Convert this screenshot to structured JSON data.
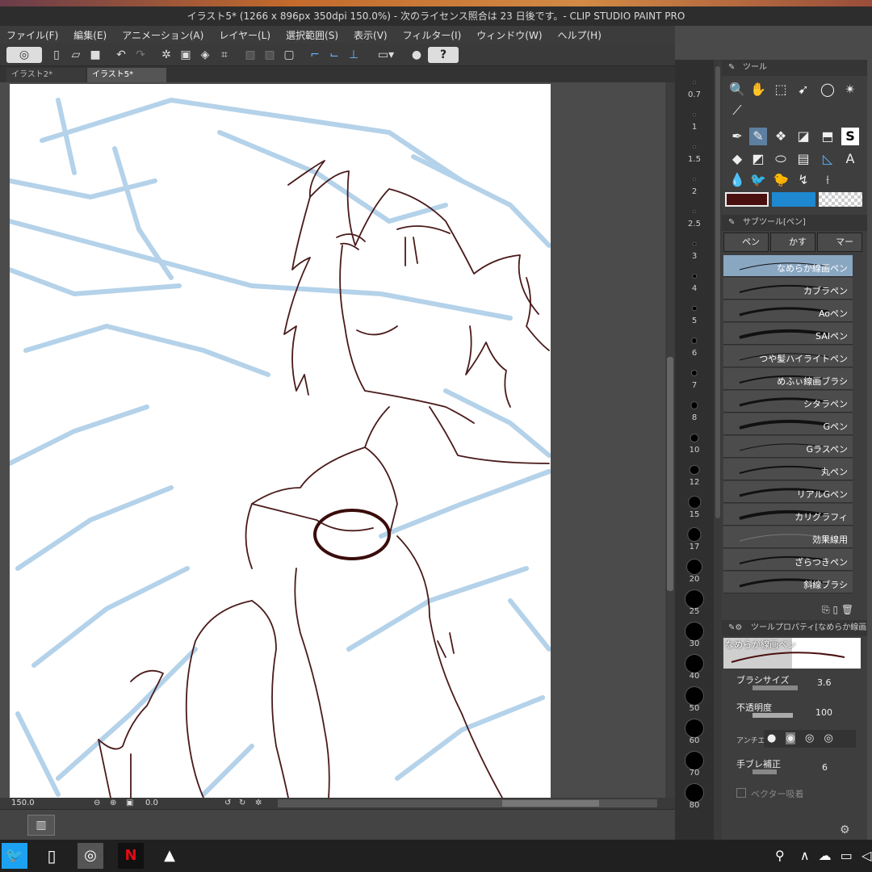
{
  "window": {
    "title": "イラスト5* (1266 x 896px 350dpi 150.0%)  - 次のライセンス照合は 23 日後です。- CLIP STUDIO PAINT PRO"
  },
  "menu": [
    "ファイル(F)",
    "編集(E)",
    "アニメーション(A)",
    "レイヤー(L)",
    "選択範囲(S)",
    "表示(V)",
    "フィルター(I)",
    "ウィンドウ(W)",
    "ヘルプ(H)"
  ],
  "tabs": [
    "イラスト2*",
    "イラスト5*"
  ],
  "status": {
    "zoom": "150.0",
    "angle": "0.0"
  },
  "brush_sizes": [
    "0.7",
    "1",
    "1.5",
    "2",
    "2.5",
    "3",
    "4",
    "5",
    "6",
    "7",
    "8",
    "10",
    "12",
    "15",
    "17",
    "20",
    "25",
    "30",
    "40",
    "50",
    "60",
    "70",
    "80"
  ],
  "tool_panel": {
    "title": "ツール"
  },
  "subtool_panel": {
    "title": "サブツール[ペン]",
    "tabs": [
      "ペン",
      "かすれ",
      "マーカ"
    ],
    "brushes": [
      "なめらか線画ペン",
      "カブラペン",
      "Aoペン",
      "SAIペン",
      "つや髪ハイライトペン",
      "めふぃ線画ブラシ",
      "シタラペン",
      "Gペン",
      "Gラスペン",
      "丸ペン",
      "リアルGペン",
      "カリグラフィ",
      "効果線用",
      "ざらつきペン",
      "斜線ブラシ"
    ],
    "selected_index": 0
  },
  "property_panel": {
    "title": "ツールプロパティ[なめらか線画ペン]",
    "preview_label": "なめらか線画ペン",
    "brush_size_label": "ブラシサイズ",
    "brush_size_value": "3.6",
    "opacity_label": "不透明度",
    "opacity_value": "100",
    "antialias_label": "アンチエ",
    "stabilization_label": "手ブレ補正",
    "stabilization_value": "6",
    "vector_snap_label": "ベクター吸着"
  },
  "colors": {
    "main_color": "#4a1010",
    "sub_color": "#1e88d0",
    "line_color": "#4a1a1a",
    "sketch_color": "#a8cbe6"
  }
}
